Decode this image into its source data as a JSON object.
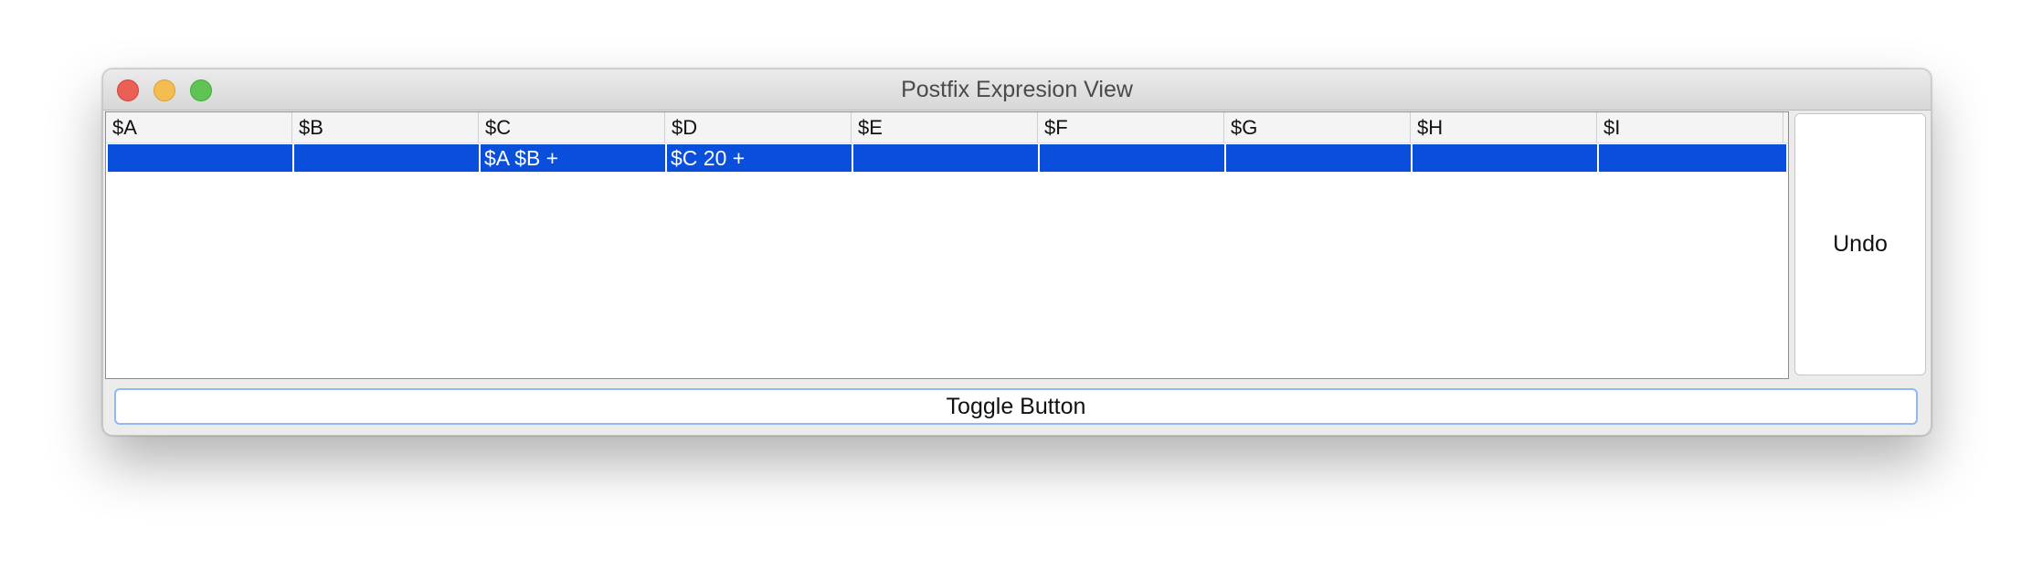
{
  "window": {
    "title": "Postfix Expresion View"
  },
  "table": {
    "headers": [
      "$A",
      "$B",
      "$C",
      "$D",
      "$E",
      "$F",
      "$G",
      "$H",
      "$I"
    ],
    "rows": [
      [
        "",
        "",
        "$A $B +",
        "$C 20 +",
        "",
        "",
        "",
        "",
        ""
      ]
    ],
    "selected_row": 0,
    "selection_color": "#0a4fdc"
  },
  "buttons": {
    "undo_label": "Undo",
    "toggle_label": "Toggle Button"
  },
  "colors": {
    "close": "#ec5f57",
    "minimize": "#f3bd4f",
    "zoom": "#5fc453",
    "focus_ring": "#8fb8f4"
  }
}
